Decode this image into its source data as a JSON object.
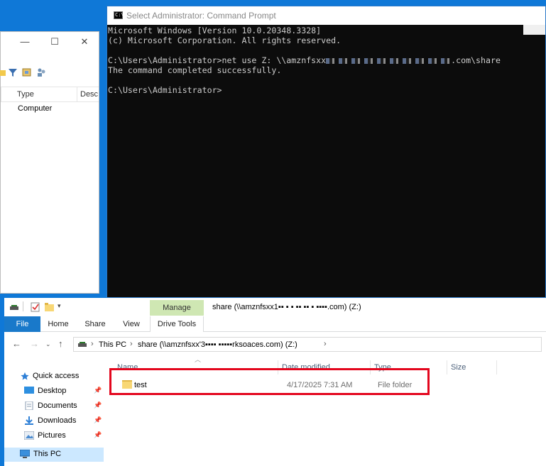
{
  "background_window": {
    "controls": {
      "minimize": "—",
      "maximize": "☐",
      "close": "✕"
    },
    "columns": [
      "Type",
      "Desc"
    ],
    "row_type": "Computer"
  },
  "cmd": {
    "title": "Select Administrator: Command Prompt",
    "icon_text": "C:\\",
    "line1": "Microsoft Windows [Version 10.0.20348.3328]",
    "line2": "(c) Microsoft Corporation. All rights reserved.",
    "line3_prefix": "C:\\Users\\Administrator>net use Z: \\\\amznfsxx",
    "line3_suffix": ".com\\share",
    "line4": "The command completed successfully.",
    "line6": "C:\\Users\\Administrator>"
  },
  "explorer": {
    "title": "share (\\\\amznfsxx1▪▪ ▪ ▪ ▪▪ ▪▪ ▪ ▪▪▪▪.com) (Z:)",
    "manage_tab": "Manage",
    "ribbon_tabs": [
      "File",
      "Home",
      "Share",
      "View",
      "Drive Tools"
    ],
    "address": {
      "crumb1": "This PC",
      "crumb2": "share (\\\\amznfsxx'3▪▪▪▪ ▪▪▪▪▪rksoaces.com) (Z:)"
    },
    "nav": {
      "quick_access": "Quick access",
      "desktop": "Desktop",
      "documents": "Documents",
      "downloads": "Downloads",
      "pictures": "Pictures",
      "this_pc": "This PC"
    },
    "columns": {
      "name": "Name",
      "date": "Date modified",
      "type": "Type",
      "size": "Size"
    },
    "files": [
      {
        "name": "test",
        "date": "4/17/2025 7:31 AM",
        "type": "File folder"
      }
    ]
  },
  "colors": {
    "desktop": "#0f78d7",
    "cmd_bg": "#0c0c0c",
    "highlight": "#e3061d",
    "manage_tab": "#cfe7b3",
    "file_tab": "#1979ca"
  }
}
